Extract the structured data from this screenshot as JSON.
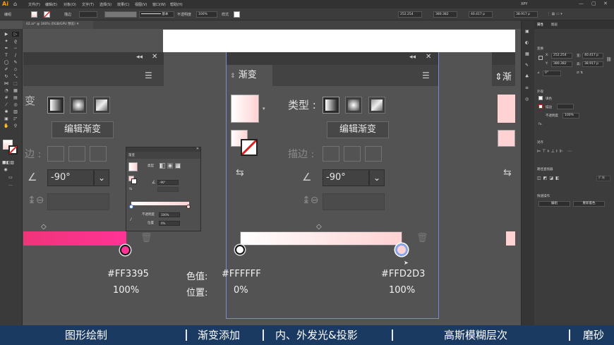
{
  "app": {
    "logo": "Ai",
    "menu": [
      "文件(F)",
      "编辑(E)",
      "对象(O)",
      "文字(T)",
      "选择(S)",
      "效果(C)",
      "视图(V)",
      "窗口(W)",
      "帮助(H)"
    ],
    "workspace": "XPY"
  },
  "controlbar": {
    "label_gradient": "渐变",
    "stroke_label": "描边",
    "stroke_style": "基本",
    "opacity_label": "不透明度",
    "opacity_value": "100%",
    "style_label": "样式",
    "x_value": "252.254",
    "y_value": "380.382",
    "w_value": "40.417 p",
    "h_value": "38.917 p"
  },
  "document": {
    "tab_title": "02.ai* @ 300% (RGB/GPU 预览)"
  },
  "gradient_panel": {
    "title": "渐变",
    "type_label": "类型 :",
    "edit_button": "编辑渐变",
    "stroke_label": "描边 :",
    "angle_value": "-90°",
    "left_title_partial": "变",
    "left_stroke_partial": "边 :"
  },
  "gradient": {
    "center_start_color": "#FFFFFF",
    "center_end_color": "#FFD2D3",
    "left_end_color": "#FF3395"
  },
  "info": {
    "left_color": "#FF3395",
    "left_position": "100%",
    "color_label": "色值:",
    "position_label": "位置:",
    "start_color": "#FFFFFF",
    "start_position": "0%",
    "end_color": "#FFD2D3",
    "end_position": "100%"
  },
  "float_panel": {
    "title": "渐变",
    "type_label": "类型",
    "angle_value": "-90°",
    "opacity_label": "不透明度",
    "opacity_value": "100%",
    "position_label": "位置",
    "position_value": "0%"
  },
  "right_panel": {
    "tab_properties": "属性",
    "tab_layers": "图层",
    "section_transform": "变换",
    "x": "252.254",
    "y": "380.382",
    "w": "40.417 p",
    "h": "38.917 p",
    "rotate": "0°",
    "section_appearance": "外观",
    "fill_label": "填色",
    "stroke_label": "描边",
    "opacity_label": "不透明度",
    "opacity_value": "100%",
    "section_align": "对齐",
    "section_pathfinder": "路径查找器",
    "expand_label": "扩展",
    "section_quick_actions": "快速操作",
    "btn_recolor": "编组",
    "btn_rearrange": "重新着色"
  },
  "footer": {
    "items": [
      "图形绘制",
      "渐变添加",
      "内、外发光&投影",
      "高斯模糊层次",
      "磨砂"
    ]
  }
}
